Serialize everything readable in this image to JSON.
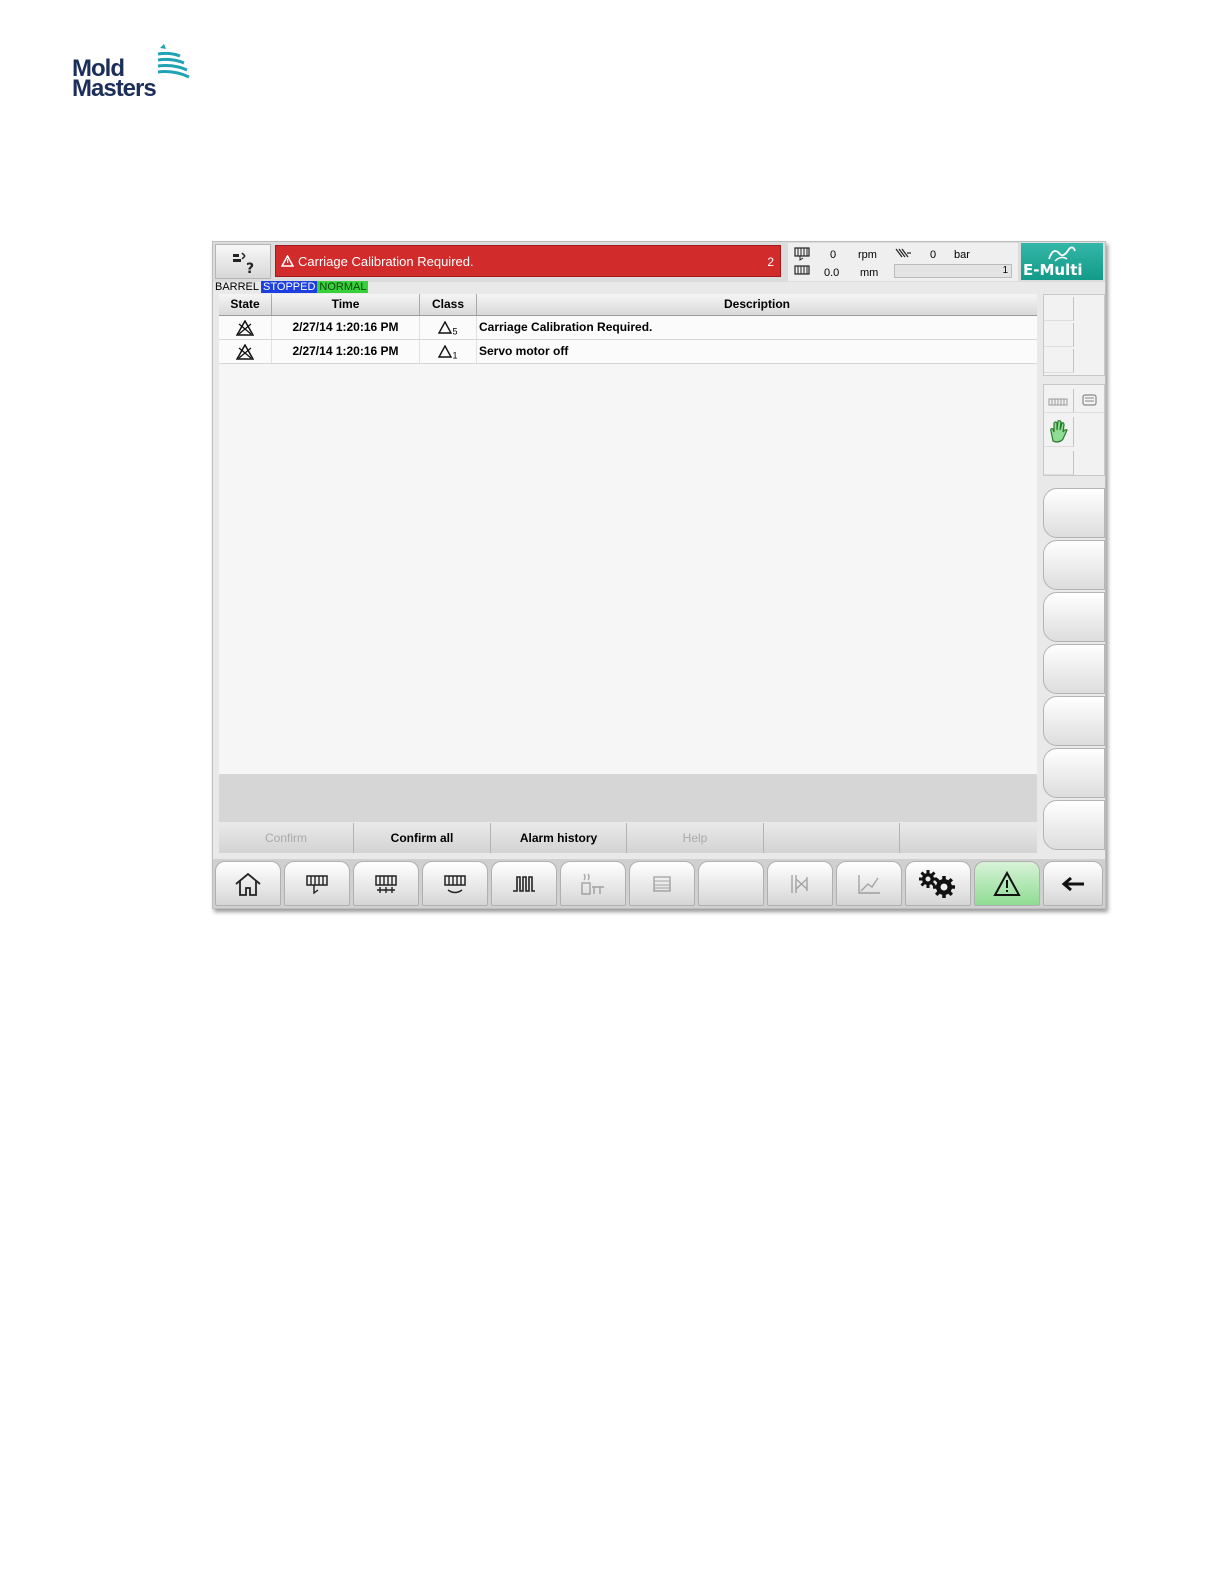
{
  "logo": {
    "line1": "Mold",
    "line2": "Masters"
  },
  "header": {
    "alarm_message": "Carriage Calibration Required.",
    "alarm_count": "2",
    "readout": {
      "value1": "0",
      "unit1": "rpm",
      "value2": "0",
      "unit2": "bar",
      "value3": "0.0",
      "unit3": "mm",
      "progress_value": "1"
    },
    "brand": "E-Multi"
  },
  "statusline": {
    "unit": "BARREL",
    "state": "STOPPED",
    "mode": "NORMAL"
  },
  "table": {
    "columns": [
      "State",
      "Time",
      "Class",
      "Description"
    ],
    "rows": [
      {
        "time": "2/27/14 1:20:16 PM",
        "class_sub": "5",
        "description": "Carriage Calibration Required."
      },
      {
        "time": "2/27/14 1:20:16 PM",
        "class_sub": "1",
        "description": "Servo motor off"
      }
    ]
  },
  "softkeys": {
    "confirm": "Confirm",
    "confirm_all": "Confirm all",
    "alarm_history": "Alarm history",
    "help": "Help"
  },
  "nav_icons": [
    "home-icon",
    "injection-icon",
    "barrel-icon",
    "carriage-icon",
    "temperature-icon",
    "dryer-icon",
    "list-icon",
    "blank",
    "valve-icon",
    "graph-icon",
    "settings-icon",
    "alarm-icon",
    "back-arrow-icon"
  ],
  "colors": {
    "alarm_red": "#d22b2b",
    "stopped_blue": "#1d3fe0",
    "normal_green": "#37d13c",
    "brand_teal": "#1fa896",
    "active_green": "#8fdc93"
  }
}
